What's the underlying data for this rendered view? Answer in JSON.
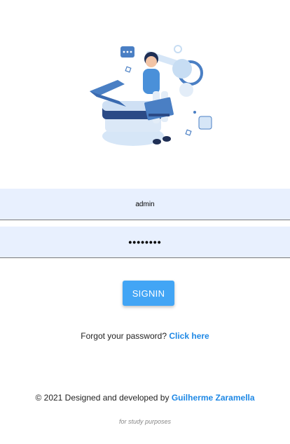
{
  "login": {
    "username_value": "admin",
    "password_value": "••••••••",
    "signin_label": "SIGNIN"
  },
  "forgot": {
    "text": "Forgot your password?",
    "link_label": "Click here"
  },
  "footer": {
    "credits_text": "© 2021 Designed and developed by",
    "author_name": "Guilherme Zaramella",
    "purpose_text": "for study purposes"
  },
  "colors": {
    "accent": "#42a5f5",
    "link": "#1e88e5",
    "input_bg": "#e8f0fe"
  }
}
